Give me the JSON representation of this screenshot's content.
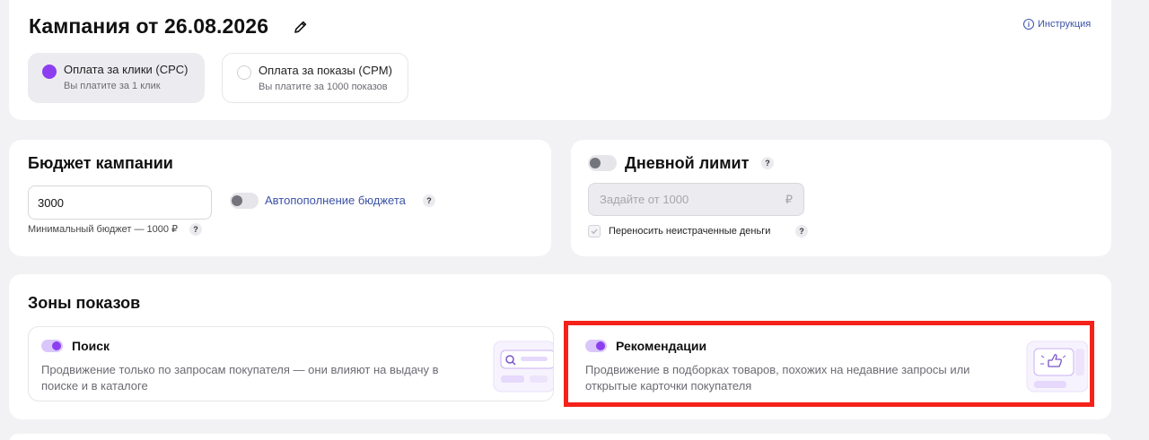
{
  "campaign": {
    "title": "Кампания от 26.08.2026",
    "help_link": "Инструкция",
    "payment_options": [
      {
        "title": "Оплата за клики (CPC)",
        "subtitle": "Вы платите за 1 клик",
        "selected": true
      },
      {
        "title": "Оплата за показы (CPM)",
        "subtitle": "Вы платите за 1000 показов",
        "selected": false
      }
    ]
  },
  "budget": {
    "title": "Бюджет кампании",
    "value": "3000",
    "autotopup_label": "Автопополнение бюджета",
    "autotopup_enabled": false,
    "min_note": "Минимальный бюджет — 1000 ₽",
    "help": "?"
  },
  "daily_limit": {
    "title": "Дневной лимит",
    "enabled": false,
    "placeholder": "Задайте от 1000",
    "currency": "₽",
    "carry_over_label": "Переносить неистраченные деньги",
    "help": "?"
  },
  "zones": {
    "title": "Зоны показов",
    "items": [
      {
        "title": "Поиск",
        "description": "Продвижение только по запросам покупателя — они влияют на выдачу в поиске и в каталоге",
        "enabled": true
      },
      {
        "title": "Рекомендации",
        "description": "Продвижение в подборках товаров, похожих на недавние запросы или открытые карточки покупателя",
        "enabled": true
      }
    ]
  },
  "colors": {
    "accent": "#8b3ff0",
    "link": "#3b52a6",
    "highlight": "#f4221a",
    "background": "#f2f2f4"
  }
}
